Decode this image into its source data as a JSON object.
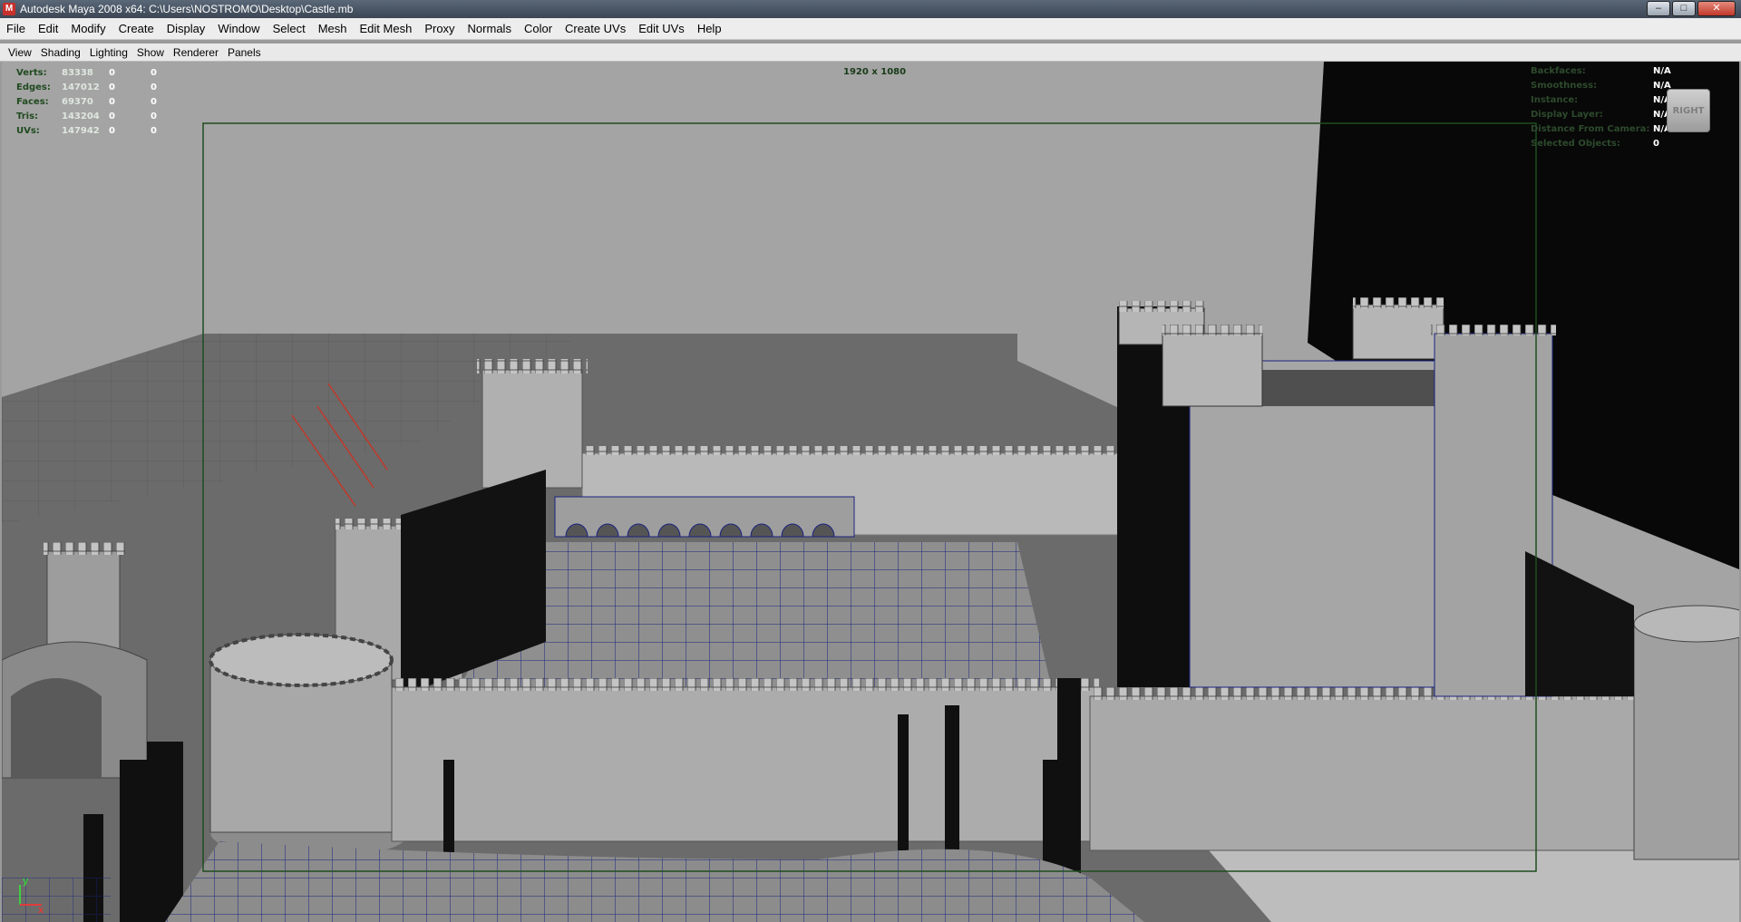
{
  "window": {
    "app_icon_letter": "M",
    "title": "Autodesk Maya 2008 x64: C:\\Users\\NOSTROMO\\Desktop\\Castle.mb",
    "buttons": {
      "minimize": "–",
      "maximize": "□",
      "close": "✕"
    }
  },
  "menubar": [
    "File",
    "Edit",
    "Modify",
    "Create",
    "Display",
    "Window",
    "Select",
    "Mesh",
    "Edit Mesh",
    "Proxy",
    "Normals",
    "Color",
    "Create UVs",
    "Edit UVs",
    "Help"
  ],
  "panel_menu": [
    "View",
    "Shading",
    "Lighting",
    "Show",
    "Renderer",
    "Panels"
  ],
  "hud_stats": [
    {
      "label": "Verts:",
      "v1": "83338",
      "v2": "0",
      "v3": "0"
    },
    {
      "label": "Edges:",
      "v1": "147012",
      "v2": "0",
      "v3": "0"
    },
    {
      "label": "Faces:",
      "v1": "69370",
      "v2": "0",
      "v3": "0"
    },
    {
      "label": "Tris:",
      "v1": "143204",
      "v2": "0",
      "v3": "0"
    },
    {
      "label": "UVs:",
      "v1": "147942",
      "v2": "0",
      "v3": "0"
    }
  ],
  "resolution_gate": "1920 x 1080",
  "hud_right": [
    {
      "label": "Backfaces:",
      "value": "N/A"
    },
    {
      "label": "Smoothness:",
      "value": "N/A"
    },
    {
      "label": "Instance:",
      "value": "N/A"
    },
    {
      "label": "Display Layer:",
      "value": "N/A"
    },
    {
      "label": "Distance From Camera:",
      "value": "N/A"
    },
    {
      "label": "Selected Objects:",
      "value": "0"
    }
  ],
  "view_cube_label": "RIGHT",
  "axis": {
    "y": "y",
    "x": "x"
  },
  "colors": {
    "wireframe": "#1a237e",
    "resolution_gate": "#1e4d1e",
    "castle_wall": "#a8a8a8",
    "shadow": "#111111"
  }
}
